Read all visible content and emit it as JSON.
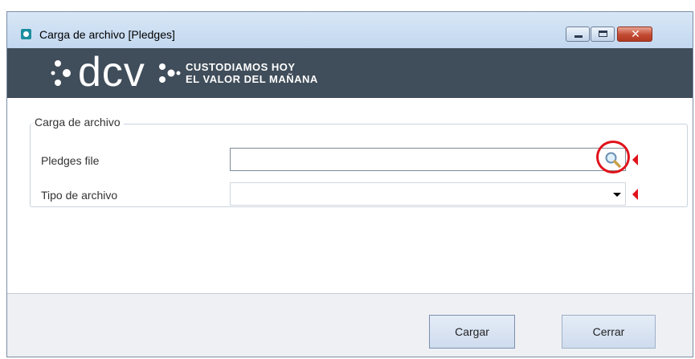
{
  "window": {
    "title": "Carga de archivo [Pledges]",
    "icon": "app-globe-icon",
    "controls": {
      "minimize_icon": "minimize-icon",
      "maximize_icon": "maximize-icon",
      "close_icon": "close-icon",
      "close_glyph": "✕"
    }
  },
  "banner": {
    "logo_text": "dcv",
    "slogan_line1": "CUSTODIAMOS HOY",
    "slogan_line2": "EL VALOR DEL MAÑANA",
    "background": "#404d5a"
  },
  "form": {
    "group_title": "Carga de archivo",
    "pledges_file": {
      "label": "Pledges file",
      "value": "",
      "search_icon": "magnifier-icon",
      "required": true
    },
    "tipo_archivo": {
      "label": "Tipo de archivo",
      "selected": "",
      "required": true
    }
  },
  "footer": {
    "cargar_label": "Cargar",
    "cerrar_label": "Cerrar"
  },
  "colors": {
    "required_marker": "#e0131b",
    "highlight_ring": "#e0131b",
    "button_gradient_top": "#e4ecf7"
  }
}
